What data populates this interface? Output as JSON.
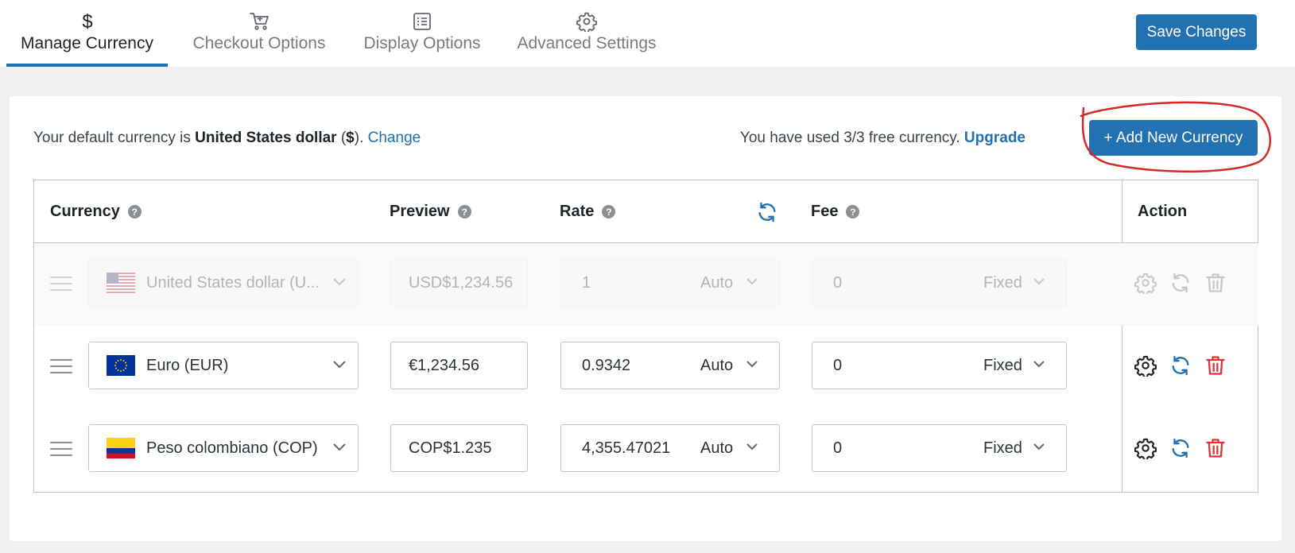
{
  "tabs": [
    {
      "label": "Manage Currency",
      "icon": "dollar-icon",
      "active": true
    },
    {
      "label": "Checkout Options",
      "icon": "cart-icon",
      "active": false
    },
    {
      "label": "Display Options",
      "icon": "list-icon",
      "active": false
    },
    {
      "label": "Advanced Settings",
      "icon": "gear-icon",
      "active": false
    }
  ],
  "header": {
    "save_label": "Save Changes"
  },
  "info": {
    "default_prefix": "Your default currency is ",
    "default_currency": "United States dollar",
    "default_symbol_prefix": " (",
    "default_symbol": "$",
    "default_symbol_suffix": ").",
    "change_label": "Change",
    "usage_text": "You have used 3/3 free currency.",
    "upgrade_label": "Upgrade",
    "add_label": "+ Add New Currency"
  },
  "colors": {
    "accent": "#2271b1",
    "danger": "#d63638",
    "annotation": "#d42a2a"
  },
  "table": {
    "headers": {
      "currency": "Currency",
      "preview": "Preview",
      "rate": "Rate",
      "fee": "Fee",
      "action": "Action"
    },
    "help_glyph": "?",
    "rows": [
      {
        "currency": "United States dollar (U...",
        "flag": "us-flag",
        "preview": "USD$1,234.56",
        "rate": "1",
        "rate_mode": "Auto",
        "fee": "0",
        "fee_mode": "Fixed",
        "disabled": true
      },
      {
        "currency": "Euro (EUR)",
        "flag": "eu-flag",
        "preview": "€1,234.56",
        "rate": "0.9342",
        "rate_mode": "Auto",
        "fee": "0",
        "fee_mode": "Fixed",
        "disabled": false
      },
      {
        "currency": "Peso colombiano (COP)",
        "flag": "colombia-flag",
        "preview": "COP$1.235",
        "rate": "4,355.47021",
        "rate_mode": "Auto",
        "fee": "0",
        "fee_mode": "Fixed",
        "disabled": false
      }
    ]
  }
}
